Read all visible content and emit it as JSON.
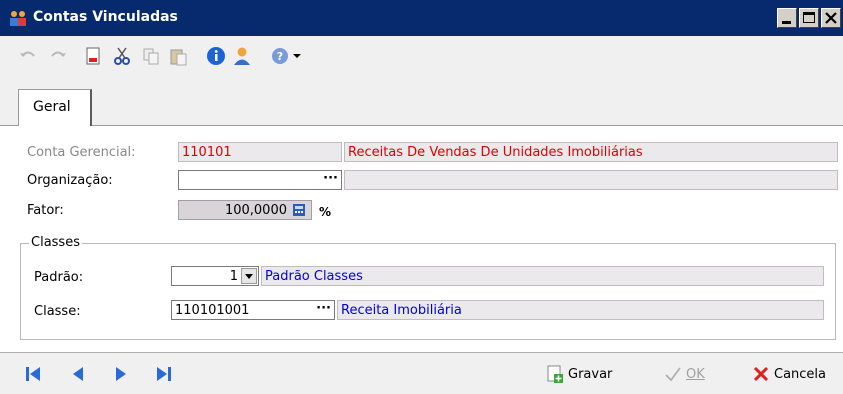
{
  "window": {
    "title": "Contas Vinculadas"
  },
  "icons": {
    "toolbar": [
      "undo-icon",
      "redo-icon",
      "new-doc-icon",
      "cut-icon",
      "copy-icon",
      "paste-icon",
      "info-icon",
      "user-icon",
      "help-icon",
      "dropdown-arrow-icon"
    ],
    "nav": [
      "first-record-icon",
      "previous-record-icon",
      "next-record-icon",
      "last-record-icon"
    ]
  },
  "tabs": [
    {
      "label": "Geral"
    }
  ],
  "form": {
    "conta_gerencial": {
      "label": "Conta Gerencial:",
      "code": "110101",
      "description": "Receitas De Vendas De Unidades Imobiliárias"
    },
    "organizacao": {
      "label": "Organização:",
      "value": "",
      "description": ""
    },
    "fator": {
      "label": "Fator:",
      "value": "100,0000",
      "unit": "%"
    }
  },
  "classes": {
    "legend": "Classes",
    "padrao": {
      "label": "Padrão:",
      "value": "1",
      "description": "Padrão Classes"
    },
    "classe": {
      "label": "Classe:",
      "value": "110101001",
      "description": "Receita Imobiliária"
    }
  },
  "actions": {
    "gravar": "Gravar",
    "ok": "OK",
    "cancela": "Cancela"
  },
  "colors": {
    "title_bg": "#072a6e",
    "readonly_bg": "#ece9ec",
    "error_text": "#e00000",
    "link_text": "#0000dd"
  }
}
